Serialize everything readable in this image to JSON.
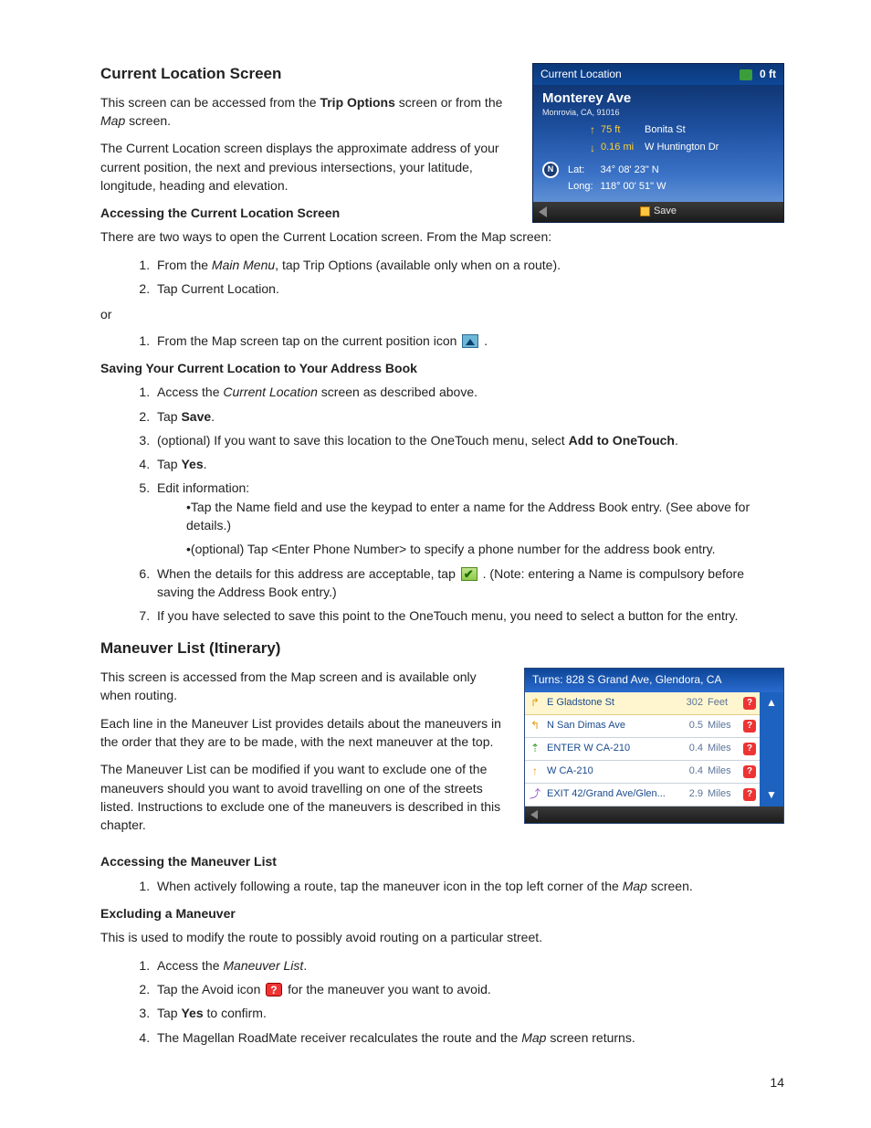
{
  "page_number": "14",
  "s1": {
    "heading": "Current Location Screen",
    "p1a": "This screen can be accessed from the ",
    "p1b": "Trip Options",
    "p1c": " screen or from the ",
    "p1d": "Map",
    "p1e": " screen.",
    "p2": "The Current Location screen displays the approximate address of your current position, the next and previous intersections, your latitude, longitude, heading and elevation.",
    "sub1": "Accessing the Current Location Screen",
    "p3": "There are two ways to open the Current Location screen. From the Map screen:",
    "li1a": "From the ",
    "li1b": "Main Menu",
    "li1c": ", tap Trip Options (available only when on a route).",
    "li2": "Tap Current Location.",
    "or": "or",
    "li3a": "From the Map screen tap on the current position icon ",
    "li3b": ".",
    "sub2": "Saving Your Current Location to Your Address Book",
    "sv1a": "Access the ",
    "sv1b": "Current Location",
    "sv1c": " screen as described above.",
    "sv2a": "Tap ",
    "sv2b": "Save",
    "sv2c": ".",
    "sv3a": "(optional) If you want to save this location to the OneTouch menu, select ",
    "sv3b": "Add to OneTouch",
    "sv3c": ".",
    "sv4a": "Tap ",
    "sv4b": "Yes",
    "sv4c": ".",
    "sv5": "Edit information:",
    "sv5b1": "•Tap the Name field and use the keypad to enter a name for the Address Book entry. (See above for details.)",
    "sv5b2": "•(optional) Tap <Enter Phone Number> to specify a phone number for the address book entry.",
    "sv6a": "When the details for this address are acceptable, tap ",
    "sv6b": ".   (Note: entering a Name is compulsory before saving the Address Book entry.)",
    "sv7": "If you have selected to save this point to the OneTouch menu, you need to select a button for the entry."
  },
  "cl_shot": {
    "title": "Current Location",
    "elev": "0 ft",
    "street": "Monterey Ave",
    "city": "Monrovia, CA, 91016",
    "up_dist": "75 ft",
    "up_road": "Bonita St",
    "dn_dist": "0.16 mi",
    "dn_road": "W Huntington Dr",
    "lat_lbl": "Lat:",
    "lat_val": "34° 08' 23\" N",
    "lon_lbl": "Long:",
    "lon_val": "118° 00' 51\" W",
    "compass": "N",
    "save": "Save"
  },
  "s2": {
    "heading": "Maneuver List (Itinerary)",
    "p1": "This screen is accessed from the Map screen and is available only when routing.",
    "p2": "Each line in the Maneuver List provides details about the maneuvers in the order that they are to be made, with the next maneuver at the top.",
    "p3": "The Maneuver List can be modified if you want to exclude one of the maneuvers should you want to avoid travelling on one of the streets listed. Instructions to exclude one of the maneuvers is described in this chapter.",
    "sub1": "Accessing the Maneuver List",
    "al1a": "When actively following a route, tap the maneuver icon in the top left corner of the ",
    "al1b": "Map",
    "al1c": " screen.",
    "sub2": "Excluding a Maneuver",
    "p4": "This is used to modify the route to possibly avoid routing on a particular street.",
    "ex1a": "Access the ",
    "ex1b": "Maneuver List",
    "ex1c": ".",
    "ex2a": "Tap the Avoid icon ",
    "ex2b": " for the maneuver you want to avoid.",
    "ex3a": "Tap ",
    "ex3b": "Yes",
    "ex3c": " to confirm.",
    "ex4a": "The Magellan RoadMate receiver recalculates the route and the ",
    "ex4b": "Map",
    "ex4c": " screen returns."
  },
  "ml_shot": {
    "header": "Turns: 828 S Grand Ave, Glendora, CA",
    "rows": [
      {
        "dir": "↱",
        "name": "E Gladstone St",
        "dist": "302",
        "unit": "Feet",
        "cls": "turn-r",
        "hl": true
      },
      {
        "dir": "↰",
        "name": "N San Dimas Ave",
        "dist": "0.5",
        "unit": "Miles",
        "cls": "turn-l",
        "hl": false
      },
      {
        "dir": "⇡",
        "name": "ENTER W CA-210",
        "dist": "0.4",
        "unit": "Miles",
        "cls": "turn-m",
        "hl": false
      },
      {
        "dir": "↑",
        "name": "W CA-210",
        "dist": "0.4",
        "unit": "Miles",
        "cls": "turn-s",
        "hl": false
      },
      {
        "dir": "⤴",
        "name": "EXIT 42/Grand Ave/Glen...",
        "dist": "2.9",
        "unit": "Miles",
        "cls": "turn-e",
        "hl": false
      }
    ]
  }
}
